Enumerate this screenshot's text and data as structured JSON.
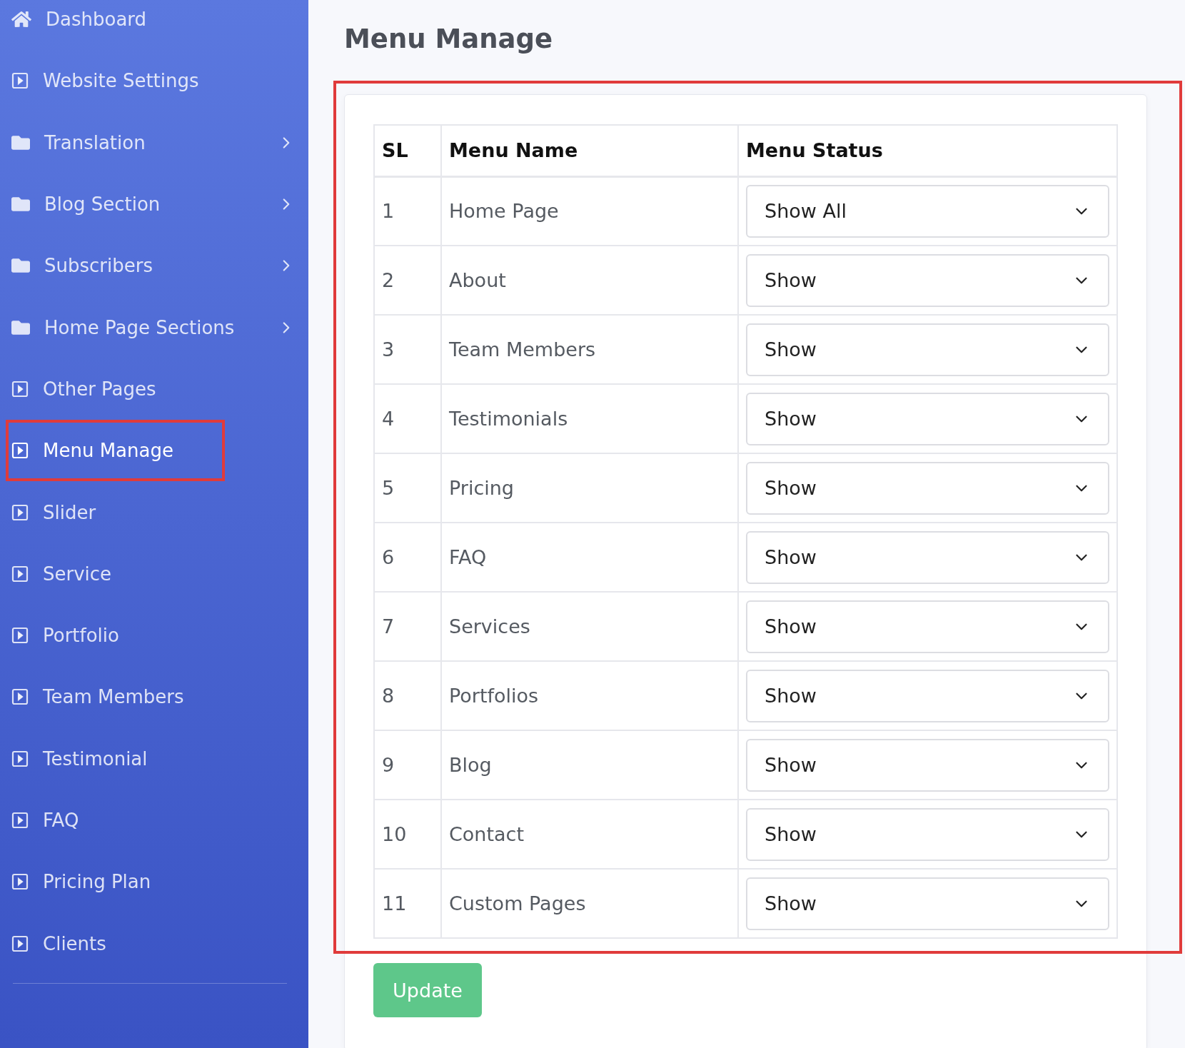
{
  "sidebar": {
    "items": [
      {
        "label": "Dashboard",
        "kind": "home",
        "has_submenu": false,
        "selected": false,
        "annotated": false
      },
      {
        "label": "Website Settings",
        "kind": "page",
        "has_submenu": false,
        "selected": false,
        "annotated": false
      },
      {
        "label": "Translation",
        "kind": "folder",
        "has_submenu": true,
        "selected": false,
        "annotated": false
      },
      {
        "label": "Blog Section",
        "kind": "folder",
        "has_submenu": true,
        "selected": false,
        "annotated": false
      },
      {
        "label": "Subscribers",
        "kind": "folder",
        "has_submenu": true,
        "selected": false,
        "annotated": false
      },
      {
        "label": "Home Page Sections",
        "kind": "folder",
        "has_submenu": true,
        "selected": false,
        "annotated": false
      },
      {
        "label": "Other Pages",
        "kind": "page",
        "has_submenu": false,
        "selected": false,
        "annotated": false
      },
      {
        "label": "Menu Manage",
        "kind": "page",
        "has_submenu": false,
        "selected": true,
        "annotated": true
      },
      {
        "label": "Slider",
        "kind": "page",
        "has_submenu": false,
        "selected": false,
        "annotated": false
      },
      {
        "label": "Service",
        "kind": "page",
        "has_submenu": false,
        "selected": false,
        "annotated": false
      },
      {
        "label": "Portfolio",
        "kind": "page",
        "has_submenu": false,
        "selected": false,
        "annotated": false
      },
      {
        "label": "Team Members",
        "kind": "page",
        "has_submenu": false,
        "selected": false,
        "annotated": false
      },
      {
        "label": "Testimonial",
        "kind": "page",
        "has_submenu": false,
        "selected": false,
        "annotated": false
      },
      {
        "label": "FAQ",
        "kind": "page",
        "has_submenu": false,
        "selected": false,
        "annotated": false
      },
      {
        "label": "Pricing Plan",
        "kind": "page",
        "has_submenu": false,
        "selected": false,
        "annotated": false
      },
      {
        "label": "Clients",
        "kind": "page",
        "has_submenu": false,
        "selected": false,
        "annotated": false
      }
    ]
  },
  "page_title": "Menu Manage",
  "table": {
    "annotated": true,
    "columns": [
      "SL",
      "Menu Name",
      "Menu Status"
    ],
    "rows": [
      {
        "sl": "1",
        "name": "Home Page",
        "status": "Show All"
      },
      {
        "sl": "2",
        "name": "About",
        "status": "Show"
      },
      {
        "sl": "3",
        "name": "Team Members",
        "status": "Show"
      },
      {
        "sl": "4",
        "name": "Testimonials",
        "status": "Show"
      },
      {
        "sl": "5",
        "name": "Pricing",
        "status": "Show"
      },
      {
        "sl": "6",
        "name": "FAQ",
        "status": "Show"
      },
      {
        "sl": "7",
        "name": "Services",
        "status": "Show"
      },
      {
        "sl": "8",
        "name": "Portfolios",
        "status": "Show"
      },
      {
        "sl": "9",
        "name": "Blog",
        "status": "Show"
      },
      {
        "sl": "10",
        "name": "Contact",
        "status": "Show"
      },
      {
        "sl": "11",
        "name": "Custom Pages",
        "status": "Show"
      }
    ]
  },
  "update_button": "Update"
}
